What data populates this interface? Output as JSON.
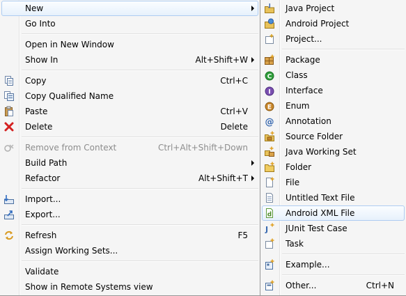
{
  "main_menu": {
    "new_label": "New",
    "go_into_label": "Go Into",
    "open_new_window_label": "Open in New Window",
    "show_in_label": "Show In",
    "show_in_shortcut": "Alt+Shift+W",
    "copy_label": "Copy",
    "copy_shortcut": "Ctrl+C",
    "copy_qualified_label": "Copy Qualified Name",
    "paste_label": "Paste",
    "paste_shortcut": "Ctrl+V",
    "delete_label": "Delete",
    "delete_shortcut": "Delete",
    "remove_context_label": "Remove from Context",
    "remove_context_shortcut": "Ctrl+Alt+Shift+Down",
    "build_path_label": "Build Path",
    "refactor_label": "Refactor",
    "refactor_shortcut": "Alt+Shift+T",
    "import_label": "Import...",
    "export_label": "Export...",
    "refresh_label": "Refresh",
    "refresh_shortcut": "F5",
    "assign_working_sets_label": "Assign Working Sets...",
    "validate_label": "Validate",
    "show_remote_label": "Show in Remote Systems view"
  },
  "new_submenu": {
    "java_project_label": "Java Project",
    "android_project_label": "Android Project",
    "project_label": "Project...",
    "package_label": "Package",
    "class_label": "Class",
    "interface_label": "Interface",
    "enum_label": "Enum",
    "annotation_label": "Annotation",
    "source_folder_label": "Source Folder",
    "java_working_set_label": "Java Working Set",
    "folder_label": "Folder",
    "file_label": "File",
    "untitled_text_file_label": "Untitled Text File",
    "android_xml_file_label": "Android XML File",
    "junit_test_case_label": "JUnit Test Case",
    "task_label": "Task",
    "example_label": "Example...",
    "other_label": "Other...",
    "other_shortcut": "Ctrl+N"
  },
  "colors": {
    "menu_background": "#f5f5f5",
    "highlight_border": "#aeccf1",
    "disabled_text": "#8d8d8d",
    "delete_icon": "#d42020",
    "class_icon": "#2e9e3a",
    "interface_icon": "#7a4fb0",
    "enum_icon": "#c8862a"
  }
}
